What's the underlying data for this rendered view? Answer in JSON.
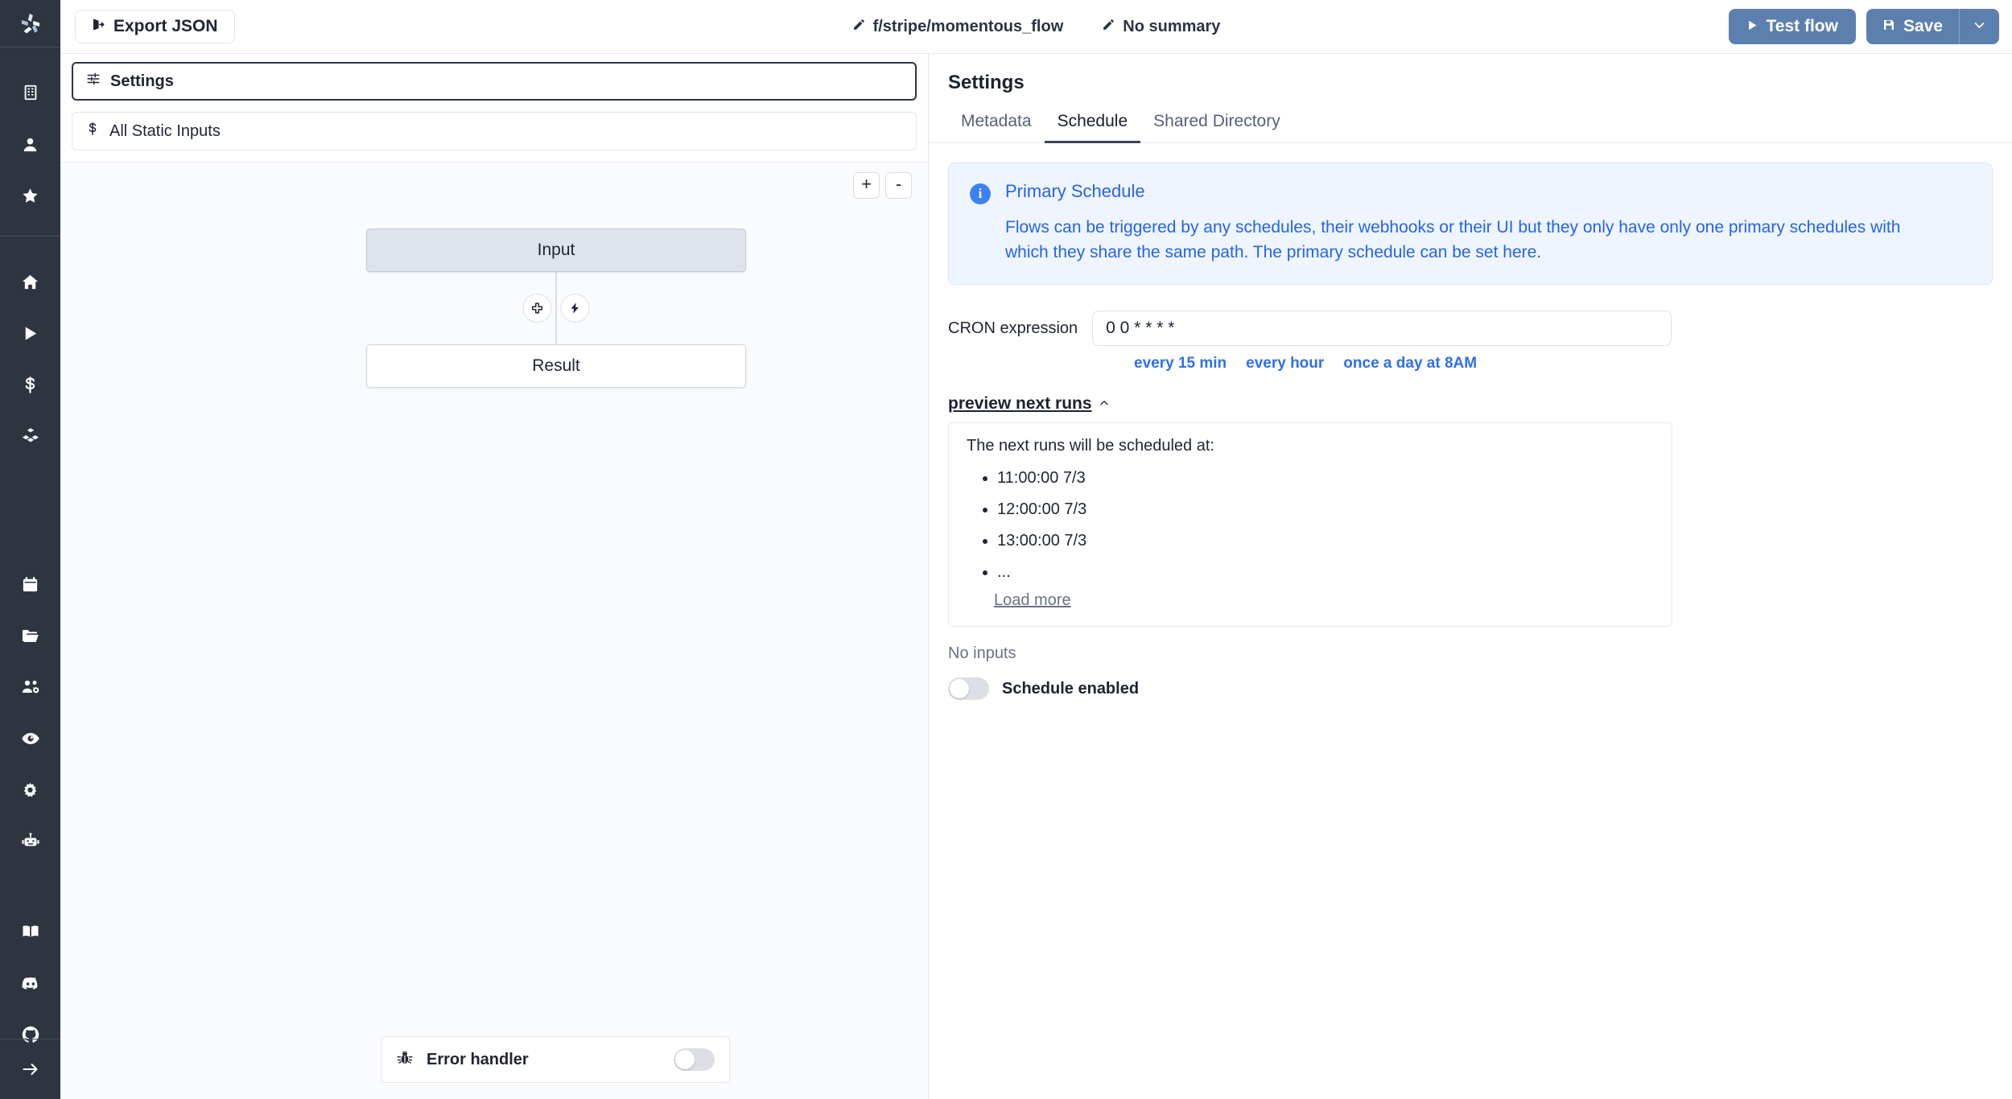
{
  "header": {
    "export_label": "Export JSON",
    "export_icon": "export-icon",
    "flow_path": "f/stripe/momentous_flow",
    "summary": "No summary",
    "edit_icon": "pencil-icon",
    "test_flow_label": "Test flow",
    "test_flow_icon": "play-icon",
    "save_label": "Save",
    "save_icon": "floppy-disk-icon",
    "save_caret_icon": "chevron-down-icon",
    "primary_color": "#5c7fae"
  },
  "rail": {
    "logo": "windmill-logo",
    "groups": [
      {
        "items": [
          {
            "name": "workspace-icon",
            "label": "Workspace"
          },
          {
            "name": "user-icon",
            "label": "User"
          },
          {
            "name": "star-icon",
            "label": "Favorites"
          }
        ]
      },
      {
        "items": [
          {
            "name": "home-icon",
            "label": "Home"
          },
          {
            "name": "runs-icon",
            "label": "Runs"
          },
          {
            "name": "variables-icon",
            "label": "Variables"
          },
          {
            "name": "resources-icon",
            "label": "Resources"
          }
        ]
      },
      {
        "items": [
          {
            "name": "schedules-icon",
            "label": "Schedules"
          },
          {
            "name": "folders-icon",
            "label": "Folders"
          },
          {
            "name": "groups-icon",
            "label": "Groups"
          },
          {
            "name": "audit-logs-icon",
            "label": "Audit logs"
          },
          {
            "name": "settings-icon",
            "label": "Settings"
          },
          {
            "name": "workers-icon",
            "label": "Workers"
          }
        ]
      },
      {
        "items": [
          {
            "name": "docs-icon",
            "label": "Documentation"
          },
          {
            "name": "discord-icon",
            "label": "Discord"
          },
          {
            "name": "github-icon",
            "label": "GitHub"
          }
        ]
      }
    ],
    "collapse": {
      "name": "expand-arrow-icon",
      "label": "Expand"
    }
  },
  "flow": {
    "modules": [
      {
        "label": "Settings",
        "icon": "sliders-icon",
        "selected": true
      },
      {
        "label": "All Static Inputs",
        "icon": "dollar-icon",
        "selected": false
      }
    ],
    "zoom_in_label": "+",
    "zoom_out_label": "-",
    "nodes": [
      {
        "label": "Input",
        "kind": "input"
      },
      {
        "label": "Result",
        "kind": "result"
      }
    ],
    "edge_buttons": [
      {
        "name": "add-node-icon",
        "label": "+"
      },
      {
        "name": "lightning-icon",
        "label": "trigger"
      }
    ],
    "error_handler": {
      "label": "Error handler",
      "icon": "bug-icon",
      "enabled": false
    }
  },
  "settings": {
    "title": "Settings",
    "tabs": [
      {
        "label": "Metadata",
        "active": false
      },
      {
        "label": "Schedule",
        "active": true
      },
      {
        "label": "Shared Directory",
        "active": false
      }
    ],
    "callout": {
      "icon": "info-icon",
      "title": "Primary Schedule",
      "body": "Flows can be triggered by any schedules, their webhooks or their UI but they only have only one primary schedules with which they share the same path. The primary schedule can be set here."
    },
    "cron": {
      "label": "CRON expression",
      "value": "0 0 * * * *",
      "placeholder": "",
      "shortcuts": [
        "every 15 min",
        "every hour",
        "once a day at 8AM"
      ]
    },
    "preview": {
      "toggle_label": "preview next runs",
      "toggle_icon": "chevron-up-icon",
      "lead": "The next runs will be scheduled at:",
      "runs": [
        "11:00:00 7/3",
        "12:00:00 7/3",
        "13:00:00 7/3",
        "..."
      ],
      "load_more": "Load more"
    },
    "no_inputs": "No inputs",
    "schedule_enabled": {
      "label": "Schedule enabled",
      "enabled": false
    }
  }
}
